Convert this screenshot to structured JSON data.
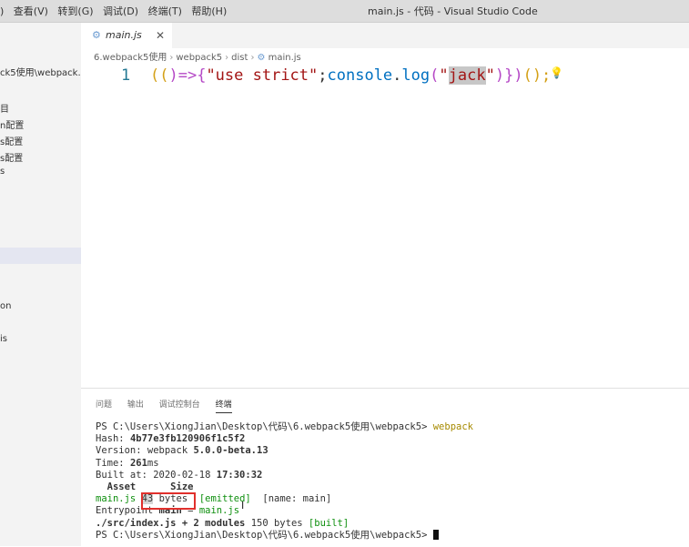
{
  "menu": [
    ")",
    "查看(V)",
    "转到(G)",
    "调试(D)",
    "终端(T)",
    "帮助(H)"
  ],
  "window_title": "main.js - 代码 - Visual Studio Code",
  "sidebar": {
    "folder": "ck5使用\\webpack...",
    "items": [
      "目",
      "n配置",
      "s配置",
      "s配置",
      "s",
      "on",
      "is"
    ]
  },
  "tab": {
    "label": "main.js"
  },
  "breadcrumb": [
    "6.webpack5使用",
    "webpack5",
    "dist",
    "main.js"
  ],
  "editor": {
    "line_number": "1",
    "code": {
      "p1": "((",
      "p2": ")=>{",
      "s1": "\"use strict\"",
      "semi": ";",
      "obj": "console",
      "dot": ".",
      "fn": "log",
      "p3": "(",
      "q1": "\"",
      "name": "jack",
      "q2": "\"",
      "p4": ")",
      "p5": "})",
      "p6": "();"
    }
  },
  "panel": {
    "tabs": [
      "问题",
      "输出",
      "调试控制台",
      "终端"
    ],
    "terminal": {
      "prompt1": "PS C:\\Users\\XiongJian\\Desktop\\代码\\6.webpack5使用\\webpack5> ",
      "cmd": "webpack",
      "hash_label": "Hash: ",
      "hash": "4b77e3fb120906f1c5f2",
      "version_label": "Version: webpack ",
      "version": "5.0.0-beta.13",
      "time_label": "Time: ",
      "time": "261",
      "time_unit": "ms",
      "built_label": "Built at: 2020-02-18 ",
      "built_time": "17:30:32",
      "header": "  Asset      Size",
      "asset": "main.js",
      "size_num": "43",
      "size_unit": " bytes",
      "emitted": "[emitted]",
      "name_tag": "  [name: main]",
      "entry_label": "Entrypoint ",
      "entry_bold": "main",
      "entry_eq": " = ",
      "entry_file": "main.js",
      "modules": "./src/index.js + 2 modules",
      "modules_size": " 150 bytes ",
      "built": "[built]",
      "prompt2": "PS C:\\Users\\XiongJian\\Desktop\\代码\\6.webpack5使用\\webpack5> "
    }
  },
  "colors": {
    "accent_red": "#e0302c",
    "terminal_green": "#0e8f0e",
    "terminal_yellow": "#a68a00"
  }
}
